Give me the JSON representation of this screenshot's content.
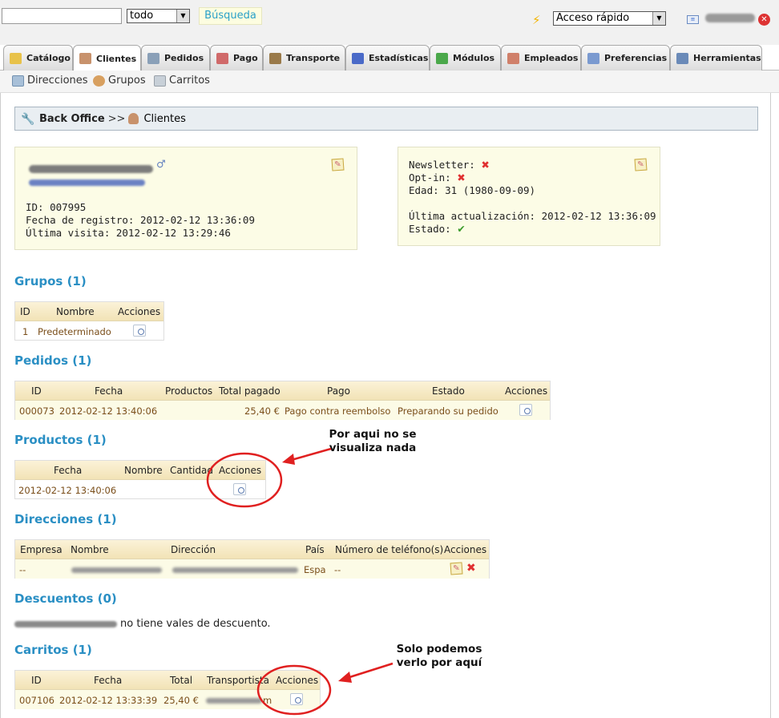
{
  "topbar": {
    "scope_value": "todo",
    "search_button": "Búsqueda",
    "quick_access": "Acceso rápido"
  },
  "tabs": [
    {
      "label": "Catálogo",
      "color": "#e8c24a"
    },
    {
      "label": "Clientes",
      "color": "#c8926c"
    },
    {
      "label": "Pedidos",
      "color": "#8aa0b8"
    },
    {
      "label": "Pago",
      "color": "#d06a6a"
    },
    {
      "label": "Transporte",
      "color": "#9a7a4a"
    },
    {
      "label": "Estadísticas",
      "color": "#4a6ac8"
    },
    {
      "label": "Módulos",
      "color": "#4aa84a"
    },
    {
      "label": "Empleados",
      "color": "#d0806a"
    },
    {
      "label": "Preferencias",
      "color": "#7a9ad0"
    },
    {
      "label": "Herramientas",
      "color": "#6a8ab8"
    }
  ],
  "subnav": [
    {
      "label": "Direcciones"
    },
    {
      "label": "Grupos"
    },
    {
      "label": "Carritos"
    }
  ],
  "breadcrumb": {
    "root": "Back Office",
    "sep": ">>",
    "current": "Clientes"
  },
  "customer": {
    "id_line": "ID: 007995",
    "registered_line": "Fecha de registro: 2012-02-12 13:36:09",
    "last_visit_line": "Última visita: 2012-02-12 13:29:46"
  },
  "status": {
    "newsletter": "Newsletter:",
    "optin": "Opt-in:",
    "age_line": "Edad: 31 (1980-09-09)",
    "updated_line": "Última actualización: 2012-02-12 13:36:09",
    "state": "Estado:"
  },
  "groups": {
    "title": "Grupos (1)",
    "headers": [
      "ID",
      "Nombre",
      "Acciones"
    ],
    "rows": [
      [
        "1",
        "Predeterminado"
      ]
    ]
  },
  "orders": {
    "title": "Pedidos (1)",
    "headers": [
      "ID",
      "Fecha",
      "Productos",
      "Total pagado",
      "Pago",
      "Estado",
      "Acciones"
    ],
    "rows": [
      [
        "000073",
        "2012-02-12 13:40:06",
        "",
        "25,40 €",
        "Pago contra reembolso",
        "Preparando su pedido"
      ]
    ]
  },
  "products": {
    "title": "Productos (1)",
    "headers": [
      "Fecha",
      "Nombre",
      "Cantidad",
      "Acciones"
    ],
    "rows": [
      [
        "2012-02-12 13:40:06",
        "",
        ""
      ]
    ]
  },
  "addresses": {
    "title": "Direcciones (1)",
    "headers": [
      "Empresa",
      "Nombre",
      "Dirección",
      "País",
      "Número de teléfono(s)",
      "Acciones"
    ],
    "rows": [
      [
        "--",
        "",
        "",
        "Espa",
        "--"
      ]
    ]
  },
  "discounts": {
    "title": "Descuentos (0)",
    "text": "no tiene vales de descuento."
  },
  "carts": {
    "title": "Carritos (1)",
    "headers": [
      "ID",
      "Fecha",
      "Total",
      "Transportista",
      "Acciones"
    ],
    "rows": [
      [
        "007106",
        "2012-02-12 13:33:39",
        "25,40 €",
        "m"
      ]
    ]
  },
  "annotations": {
    "note1": "Por aqui no se visualiza nada",
    "note2": "Solo podemos verlo por aquí",
    "color": "#e02020"
  }
}
